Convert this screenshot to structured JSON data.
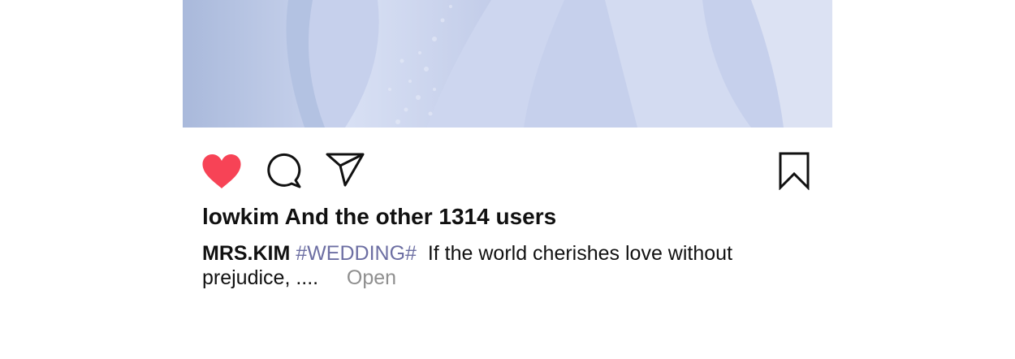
{
  "post": {
    "likes_text": "lowkim And the other 1314 users",
    "caption": {
      "author": "MRS.KIM",
      "hashtag": "#WEDDING#",
      "text": "If the world cherishes love without prejudice, ....",
      "more_label": "Open"
    }
  },
  "actions": {
    "like": {
      "icon": "heart-icon",
      "liked": true,
      "color": "#f74356"
    },
    "comment": {
      "icon": "comment-icon"
    },
    "share": {
      "icon": "send-icon"
    },
    "save": {
      "icon": "bookmark-icon"
    }
  },
  "colors": {
    "hashtag": "#6d6fa3",
    "more_link": "#8f8f8f",
    "text": "#111111",
    "photo_tint": "#c9d3ee"
  }
}
